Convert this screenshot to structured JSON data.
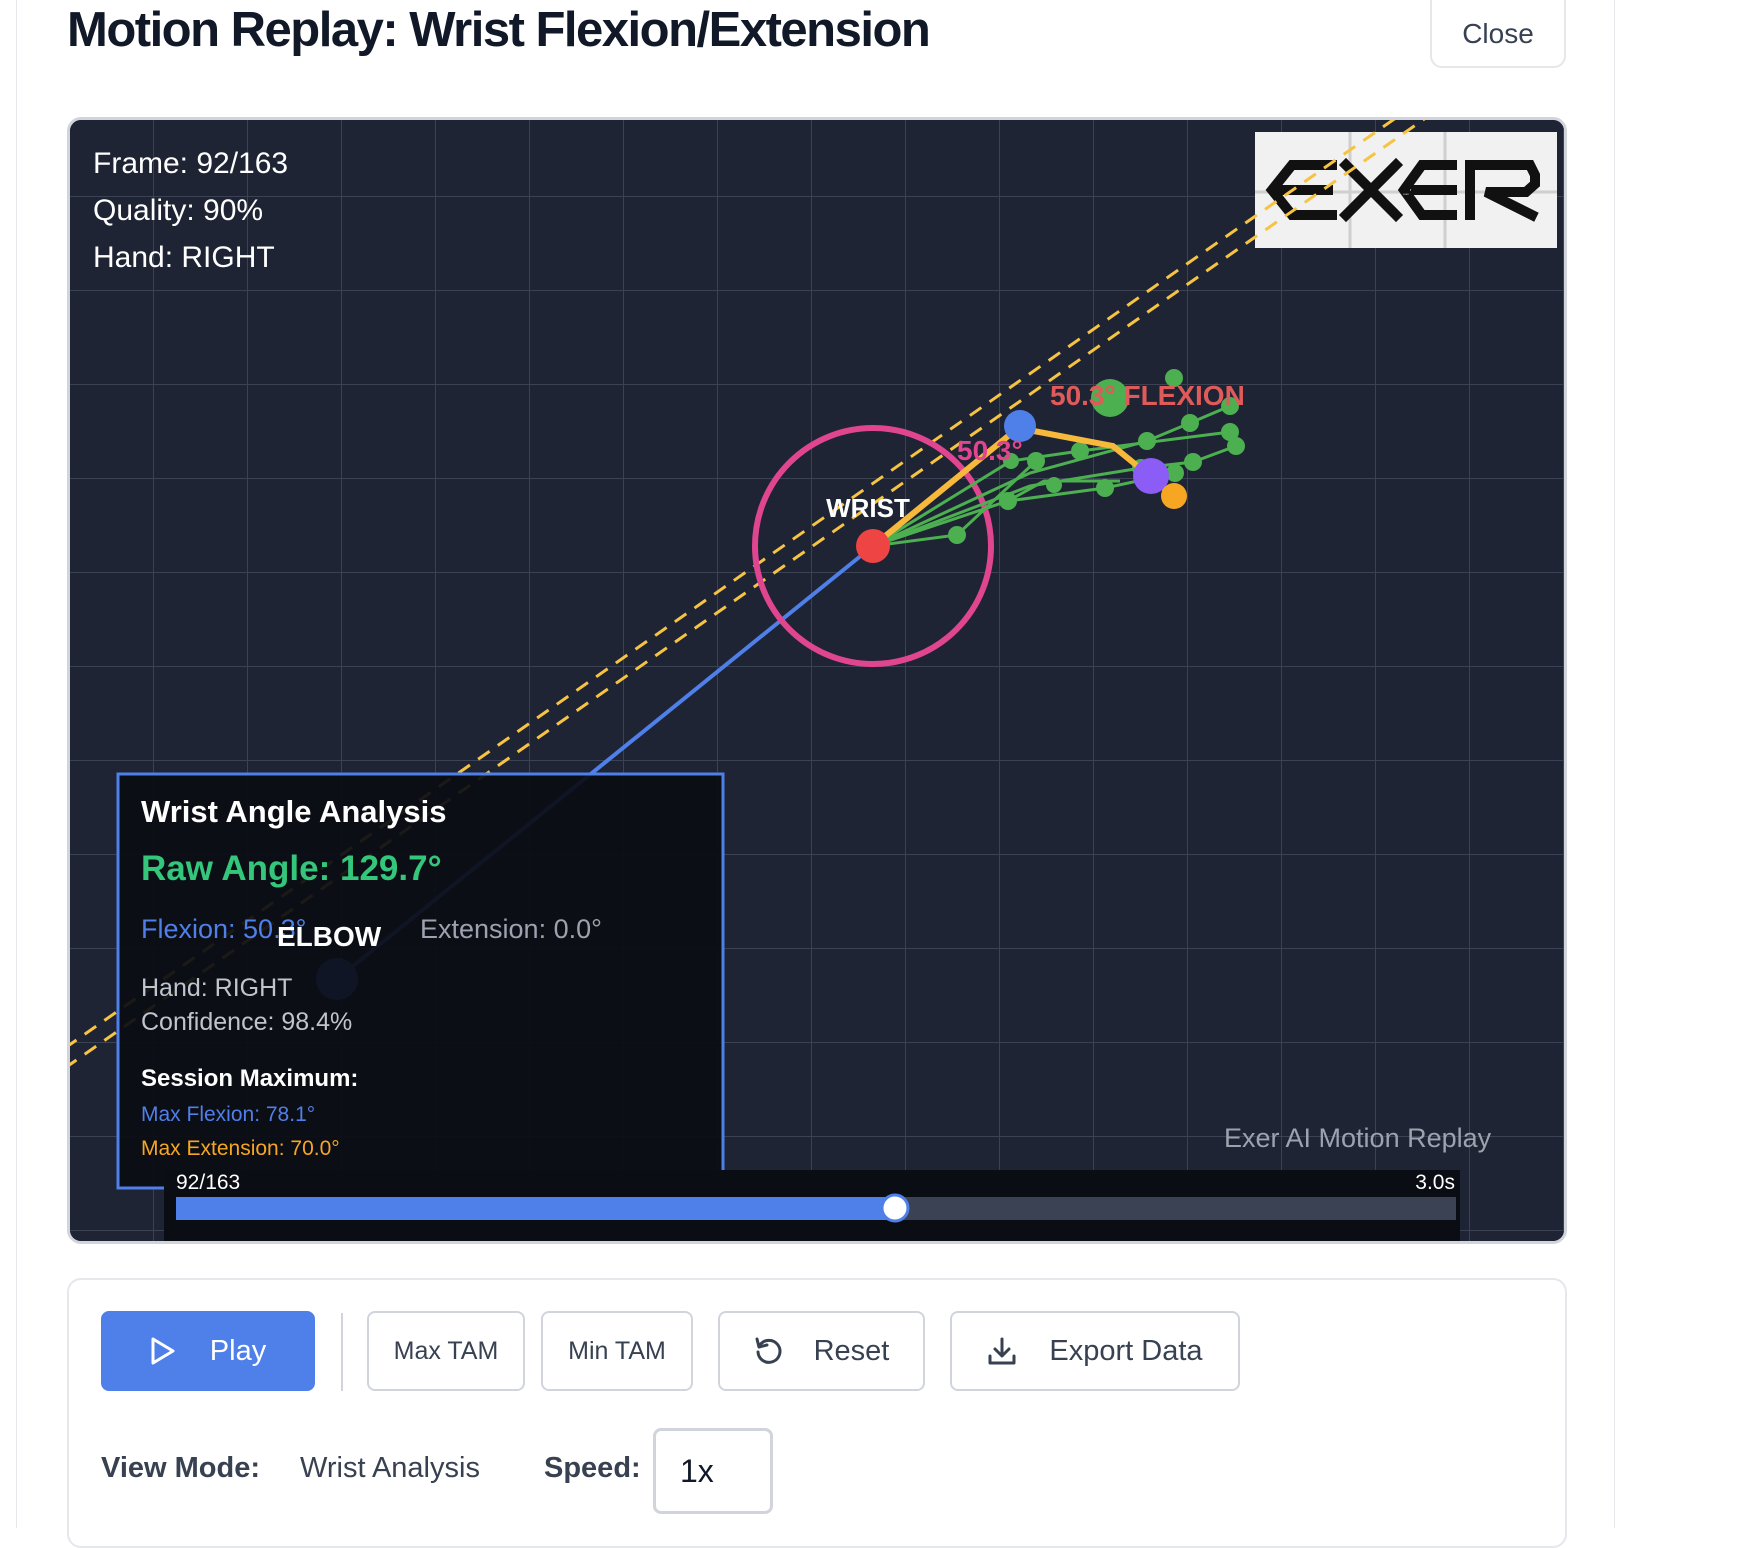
{
  "header": {
    "title": "Motion Replay: Wrist Flexion/Extension",
    "close_label": "Close"
  },
  "canvas": {
    "overlay": {
      "frame": "Frame: 92/163",
      "quality": "Quality: 90%",
      "hand": "Hand: RIGHT"
    },
    "logo_text": "EXER",
    "labels": {
      "wrist": "WRIST",
      "elbow": "ELBOW",
      "flexion_tag": "50.3° FLEXION",
      "arc_angle": "50.3°"
    },
    "analysis": {
      "title": "Wrist Angle Analysis",
      "raw_angle": "Raw Angle: 129.7°",
      "flexion": "Flexion: 50.3°",
      "extension": "Extension: 0.0°",
      "hand": "Hand: RIGHT",
      "confidence": "Confidence: 98.4%",
      "session_title": "Session Maximum:",
      "max_flexion": "Max Flexion: 78.1°",
      "max_extension": "Max Extension: 70.0°"
    },
    "watermark": "Exer AI Motion Replay",
    "timeline": {
      "frame_label": "92/163",
      "time_label": "3.0s",
      "progress": 0.5617
    },
    "colors": {
      "background": "#1e2433",
      "wrist": "#ef4444",
      "wrist_ring": "#e0458f",
      "elbow": "#4f7fe8",
      "flexion": "#e05a5a",
      "raw_angle": "#34c77b",
      "finger": "#4caf50",
      "hand_segment": "#f6b93b"
    }
  },
  "controls": {
    "play_label": "Play",
    "max_tam_label": "Max TAM",
    "min_tam_label": "Min TAM",
    "reset_label": "Reset",
    "export_label": "Export Data",
    "view_mode_label": "View Mode:",
    "view_mode_value": "Wrist Analysis",
    "speed_label": "Speed:",
    "speed_value": "1x"
  }
}
